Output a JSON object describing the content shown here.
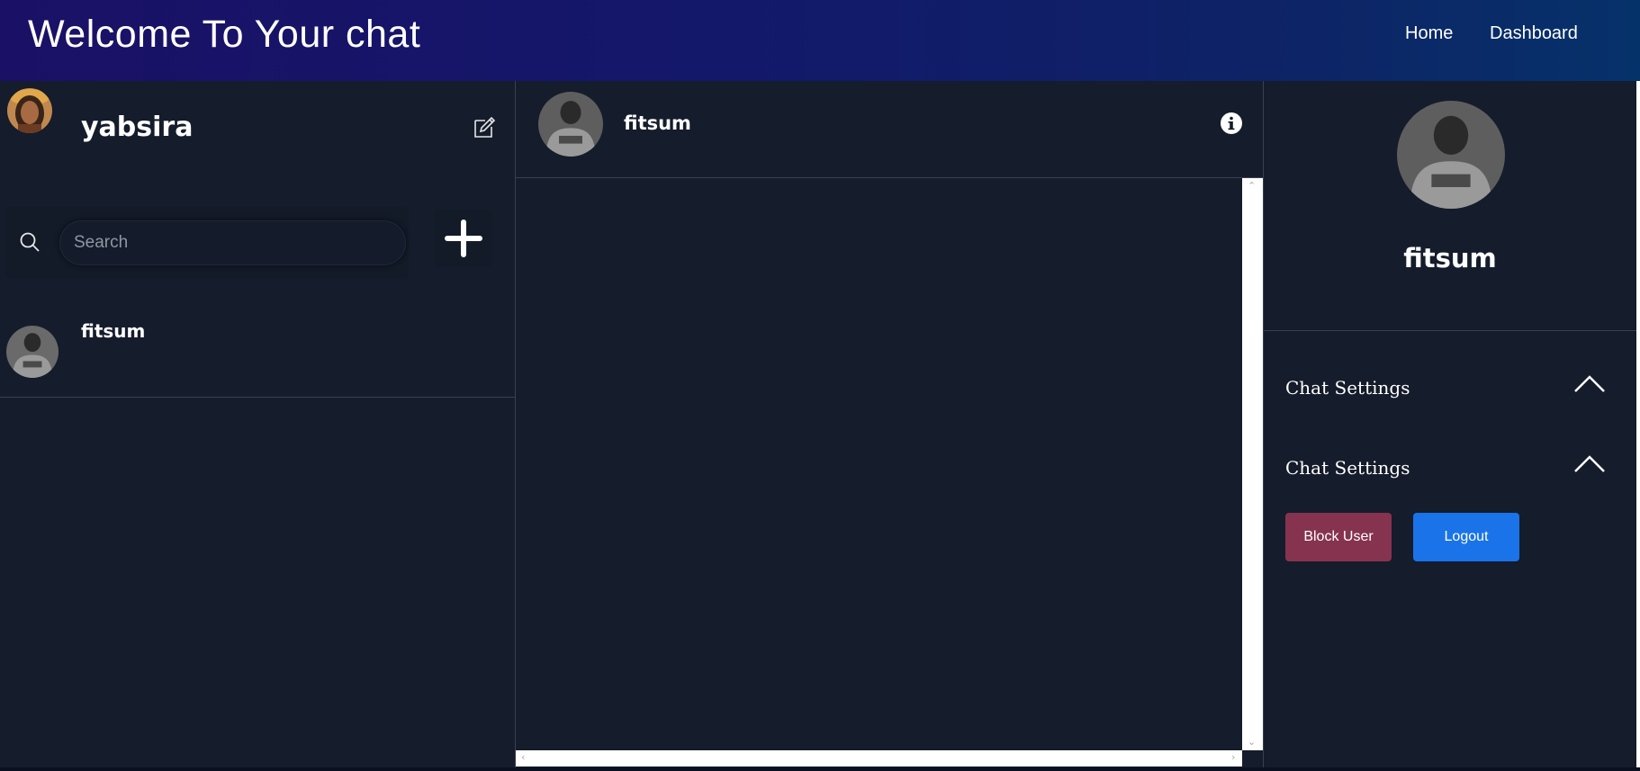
{
  "header": {
    "title": "Welcome To Your chat",
    "nav": {
      "home": "Home",
      "dashboard": "Dashboard"
    }
  },
  "sidebar": {
    "current_user": {
      "name": "yabsira",
      "avatar_icon": "user-avatar-photo"
    },
    "edit_icon": "edit-icon",
    "search": {
      "placeholder": "Search",
      "value": ""
    },
    "add_icon": "plus-icon",
    "contacts": [
      {
        "name": "fitsum",
        "avatar_icon": "contact-avatar-photo"
      }
    ]
  },
  "chat": {
    "header": {
      "name": "fitsum",
      "info_icon": "info-icon"
    },
    "messages": []
  },
  "profile": {
    "name": "fitsum",
    "settings": [
      {
        "label": "Chat Settings",
        "icon": "chevron-up-icon"
      },
      {
        "label": "Chat Settings",
        "icon": "chevron-up-icon"
      }
    ],
    "buttons": {
      "block": "Block User",
      "logout": "Logout"
    }
  },
  "colors": {
    "header_gradient_start": "#1a1166",
    "header_gradient_end": "#06326a",
    "background": "#151c2b",
    "block_button": "#86334f",
    "logout_button": "#1a73e8"
  }
}
